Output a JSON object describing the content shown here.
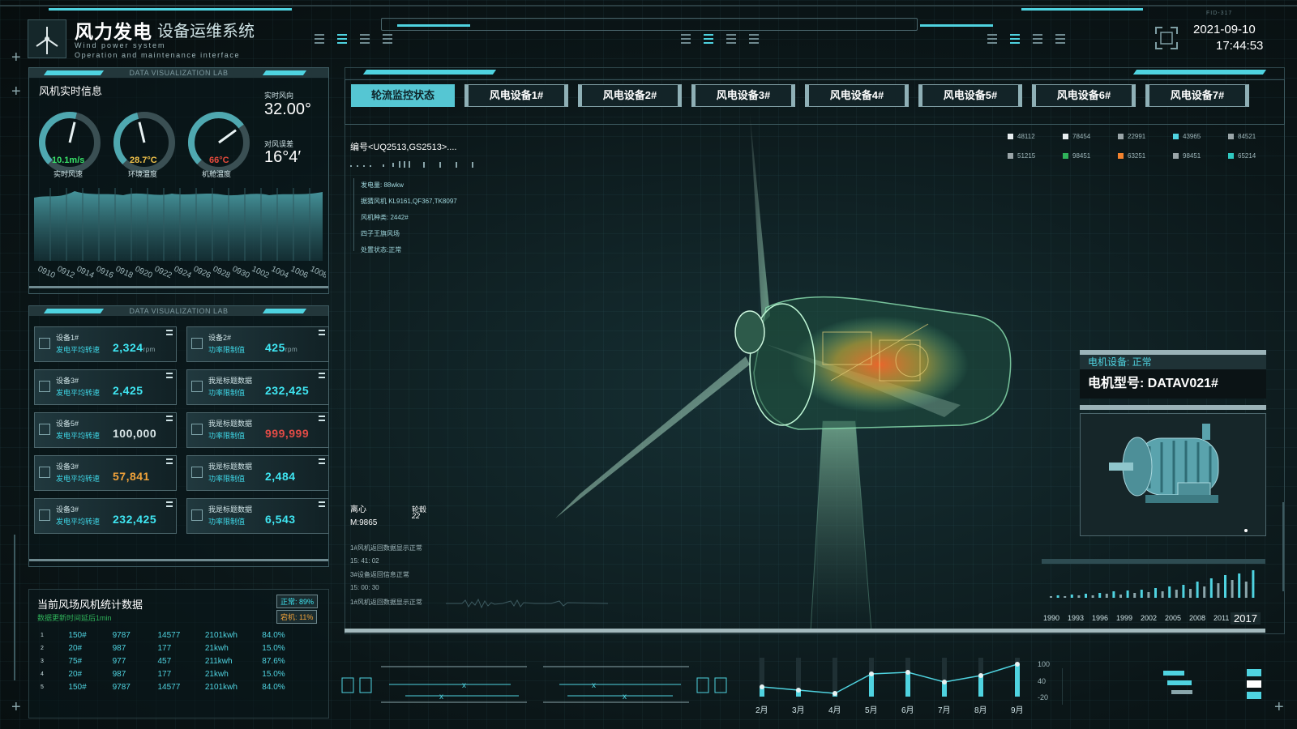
{
  "header": {
    "title_main": "风力发电",
    "title_sub": "设备运维系统",
    "subtitle_en1": "Wind power system",
    "subtitle_en2": "Operation and maintenance interface",
    "date": "2021-09-10",
    "time": "17:44:53",
    "top_right_tag": "FID-317"
  },
  "panel1": {
    "lab_label": "DATA VISUALIZATION LAB",
    "title": "风机实时信息",
    "gauges": [
      {
        "value_text": "10.1m/s",
        "label": "实时风速",
        "color": "#39e36a",
        "level": 0.55
      },
      {
        "value_text": "28.7°C",
        "label": "环境温度",
        "color": "#f2c34a",
        "level": 0.45
      },
      {
        "value_text": "66°C",
        "label": "机舱温度",
        "color": "#e84b3c",
        "level": 0.7
      }
    ],
    "wind_dir_label": "实时风向",
    "wind_dir_value": "32.00°",
    "wind_err_label": "对风误差",
    "wind_err_value": "16°4′",
    "x_labels": [
      "0910",
      "0912",
      "0914",
      "0916",
      "0918",
      "0920",
      "0922",
      "0924",
      "0926",
      "0928",
      "0930",
      "1002",
      "1004",
      "1006",
      "1008"
    ]
  },
  "panel2": {
    "lab_label": "DATA VISUALIZATION LAB",
    "cards": [
      {
        "name1": "设备1#",
        "name2": "发电平均转速",
        "value": "2,324",
        "unit": "rpm",
        "color": "#3fe6f2"
      },
      {
        "name1": "设备2#",
        "name2": "功率限制值",
        "value": "425",
        "unit": "rpm",
        "color": "#3fe6f2"
      },
      {
        "name1": "设备3#",
        "name2": "发电平均转速",
        "value": "2,425",
        "unit": "",
        "color": "#3fe6f2"
      },
      {
        "name1": "我是标题数据",
        "name2": "功率限制值",
        "value": "232,425",
        "unit": "",
        "color": "#3fe6f2"
      },
      {
        "name1": "设备5#",
        "name2": "发电平均转速",
        "value": "100,000",
        "unit": "",
        "color": "#d8e4e6"
      },
      {
        "name1": "我是标题数据",
        "name2": "功率限制值",
        "value": "999,999",
        "unit": "",
        "color": "#e24b46"
      },
      {
        "name1": "设备3#",
        "name2": "发电平均转速",
        "value": "57,841",
        "unit": "",
        "color": "#f2a33a"
      },
      {
        "name1": "我是标题数据",
        "name2": "功率限制值",
        "value": "2,484",
        "unit": "",
        "color": "#3fe6f2"
      },
      {
        "name1": "设备3#",
        "name2": "发电平均转速",
        "value": "232,425",
        "unit": "",
        "color": "#3fe6f2"
      },
      {
        "name1": "我是标题数据",
        "name2": "功率限制值",
        "value": "6,543",
        "unit": "",
        "color": "#3fe6f2"
      }
    ]
  },
  "panel3": {
    "title": "当前风场风机统计数据",
    "update_note": "数据更新时间延后1min",
    "badge_normal": "正常: 89%",
    "badge_down": "宕机: 11%",
    "rows": [
      [
        "1",
        "150#",
        "9787",
        "14577",
        "2101kwh",
        "84.0%"
      ],
      [
        "2",
        "20#",
        "987",
        "177",
        "21kwh",
        "15.0%"
      ],
      [
        "3",
        "75#",
        "977",
        "457",
        "211kwh",
        "87.6%"
      ],
      [
        "4",
        "20#",
        "987",
        "177",
        "21kwh",
        "15.0%"
      ],
      [
        "5",
        "150#",
        "9787",
        "14577",
        "2101kwh",
        "84.0%"
      ]
    ]
  },
  "tabs": [
    "轮流监控状态",
    "风电设备1#",
    "风电设备2#",
    "风电设备3#",
    "风电设备4#",
    "风电设备5#",
    "风电设备6#",
    "风电设备7#"
  ],
  "main": {
    "code": "编号<UQ2513,GS2513>....",
    "info": [
      "发电量: 88wkw",
      "据猜风机 KL9161,QF367,TK8097",
      "风机种类: 2442#",
      "四子王旗风场",
      "处置状态:正常"
    ],
    "legend": [
      {
        "label": "48112",
        "color": "#e8eef0"
      },
      {
        "label": "78454",
        "color": "#e8eef0"
      },
      {
        "label": "22991",
        "color": "#9aa5a8"
      },
      {
        "label": "43965",
        "color": "#4fd3e0"
      },
      {
        "label": "84521",
        "color": "#9aa5a8"
      },
      {
        "label": "51215",
        "color": "#9aa5a8"
      },
      {
        "label": "98451",
        "color": "#2fb35a"
      },
      {
        "label": "63251",
        "color": "#f2822e"
      },
      {
        "label": "98451",
        "color": "#9aa5a8"
      },
      {
        "label": "65214",
        "color": "#2fc8c0"
      }
    ],
    "ecc_label": "离心",
    "ecc_value": "M:9865",
    "hub_label": "轮毂",
    "hub_value": "22",
    "log": [
      "1#风机返回数据显示正常",
      "15: 41: 02",
      "3#设备返回信息正常",
      "15: 00: 30",
      "1#风机返回数据显示正常"
    ]
  },
  "motor": {
    "status": "电机设备: 正常",
    "model": "电机型号: DATAV021#",
    "year_labels": [
      "1990",
      "1993",
      "1996",
      "1999",
      "2002",
      "2005",
      "2008",
      "2011",
      "201"
    ],
    "year_badge": "2017"
  },
  "bottom_chart": {
    "months": [
      "2月",
      "3月",
      "4月",
      "5月",
      "6月",
      "7月",
      "8月",
      "9月"
    ],
    "y_ticks": [
      "100",
      "40",
      "-20"
    ]
  },
  "colors": {
    "accent": "#4fd3e0",
    "panel_border": "#3d5a60"
  }
}
